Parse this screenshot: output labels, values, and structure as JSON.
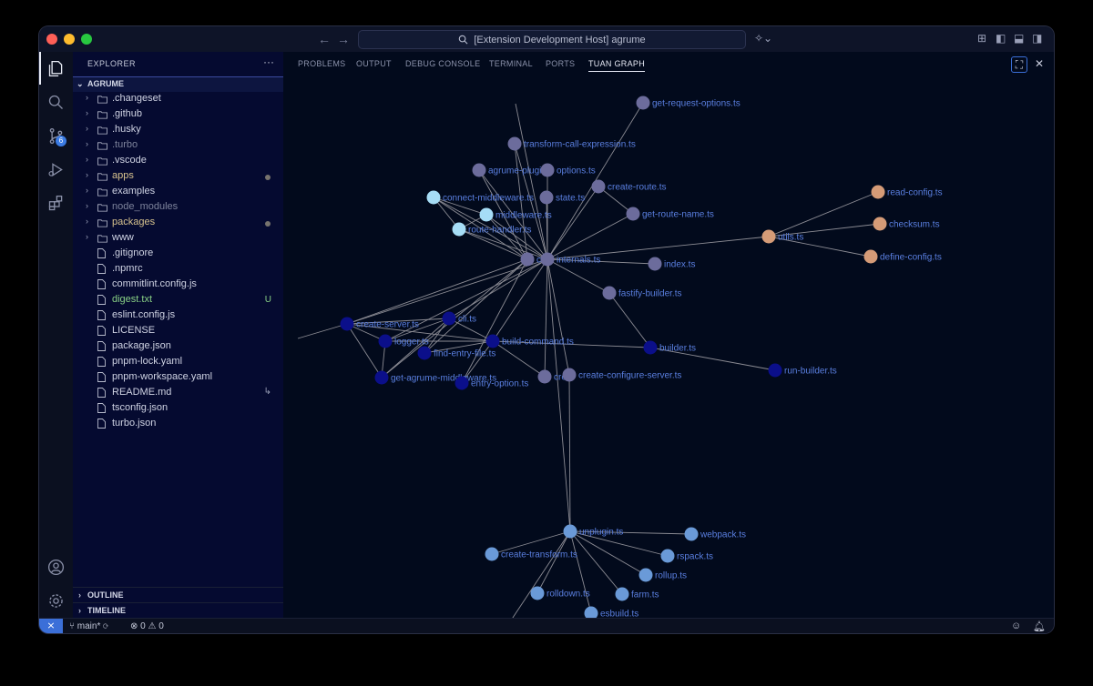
{
  "window": {
    "title": "[Extension Development Host] agrume"
  },
  "sidebar": {
    "title": "EXPLORER",
    "more": "···",
    "root": "AGRUME",
    "items": [
      {
        "label": ".changeset",
        "kind": "folder"
      },
      {
        "label": ".github",
        "kind": "folder"
      },
      {
        "label": ".husky",
        "kind": "folder"
      },
      {
        "label": ".turbo",
        "kind": "folder",
        "dim": true
      },
      {
        "label": ".vscode",
        "kind": "folder"
      },
      {
        "label": "apps",
        "kind": "folder",
        "modified": true
      },
      {
        "label": "examples",
        "kind": "folder"
      },
      {
        "label": "node_modules",
        "kind": "folder",
        "dim": true
      },
      {
        "label": "packages",
        "kind": "folder",
        "modified": true
      },
      {
        "label": "www",
        "kind": "folder"
      },
      {
        "label": ".gitignore",
        "kind": "file"
      },
      {
        "label": ".npmrc",
        "kind": "file"
      },
      {
        "label": "commitlint.config.js",
        "kind": "file"
      },
      {
        "label": "digest.txt",
        "kind": "file",
        "status": "U"
      },
      {
        "label": "eslint.config.js",
        "kind": "file"
      },
      {
        "label": "LICENSE",
        "kind": "file"
      },
      {
        "label": "package.json",
        "kind": "file"
      },
      {
        "label": "pnpm-lock.yaml",
        "kind": "file"
      },
      {
        "label": "pnpm-workspace.yaml",
        "kind": "file"
      },
      {
        "label": "README.md",
        "kind": "file",
        "glyph": "↳"
      },
      {
        "label": "tsconfig.json",
        "kind": "file"
      },
      {
        "label": "turbo.json",
        "kind": "file"
      }
    ],
    "outline": "OUTLINE",
    "timeline": "TIMELINE"
  },
  "activity": {
    "scm_badge": "6"
  },
  "panel": {
    "tabs": [
      "PROBLEMS",
      "OUTPUT",
      "DEBUG CONSOLE",
      "TERMINAL",
      "PORTS",
      "TUAN GRAPH"
    ],
    "active_tab": "TUAN GRAPH"
  },
  "graph": {
    "colors": {
      "purple": "#6c6c9c",
      "lightblue": "#a6ddf6",
      "navy": "#0b0f8a",
      "blue": "#6a9ad8",
      "peach": "#d59b77",
      "edge": "#8c8c94",
      "label": "#5a7fe0"
    },
    "nodes": [
      {
        "id": "get-request-options",
        "label": "get-request-options.ts",
        "color": "purple"
      },
      {
        "id": "transform-call-expression",
        "label": "transform-call-expression.ts",
        "color": "purple"
      },
      {
        "id": "agrume-plugin",
        "label": "agrume-plugin",
        "color": "purple"
      },
      {
        "id": "options",
        "label": "options.ts",
        "color": "purple"
      },
      {
        "id": "create-route",
        "label": "create-route.ts",
        "color": "purple"
      },
      {
        "id": "connect-middleware",
        "label": "connect-middleware.ts",
        "color": "lightblue"
      },
      {
        "id": "state",
        "label": "state.ts",
        "color": "purple"
      },
      {
        "id": "middleware",
        "label": "middleware.ts",
        "color": "lightblue"
      },
      {
        "id": "get-route-name",
        "label": "get-route-name.ts",
        "color": "purple"
      },
      {
        "id": "route-handler",
        "label": "route-handler.ts",
        "color": "lightblue"
      },
      {
        "id": "c",
        "label": "c",
        "color": "purple"
      },
      {
        "id": "internals",
        "label": "internals.ts",
        "color": "purple"
      },
      {
        "id": "index",
        "label": "index.ts",
        "color": "purple"
      },
      {
        "id": "fastify-builder",
        "label": "fastify-builder.ts",
        "color": "purple"
      },
      {
        "id": "read-config",
        "label": "read-config.ts",
        "color": "peach"
      },
      {
        "id": "checksum",
        "label": "checksum.ts",
        "color": "peach"
      },
      {
        "id": "utils",
        "label": "utils.ts",
        "color": "peach"
      },
      {
        "id": "define-config",
        "label": "define-config.ts",
        "color": "peach"
      },
      {
        "id": "create-server",
        "label": "create-server.ts",
        "color": "navy"
      },
      {
        "id": "cli",
        "label": "cli.ts",
        "color": "navy"
      },
      {
        "id": "logger",
        "label": "logger.ts",
        "color": "navy"
      },
      {
        "id": "build-command",
        "label": "build-command.ts",
        "color": "navy"
      },
      {
        "id": "find-entry-file",
        "label": "find-entry-file.ts",
        "color": "navy"
      },
      {
        "id": "builder",
        "label": "builder.ts",
        "color": "navy"
      },
      {
        "id": "run-builder",
        "label": "run-builder.ts",
        "color": "navy"
      },
      {
        "id": "get-agrume-middleware",
        "label": "get-agrume-middleware.ts",
        "color": "navy"
      },
      {
        "id": "entry-option",
        "label": "entry-option.ts",
        "color": "navy"
      },
      {
        "id": "cre",
        "label": "cre",
        "color": "purple"
      },
      {
        "id": "create-configure-server",
        "label": "create-configure-server.ts",
        "color": "purple"
      },
      {
        "id": "unplugin",
        "label": "unplugin.ts",
        "color": "blue"
      },
      {
        "id": "webpack",
        "label": "webpack.ts",
        "color": "blue"
      },
      {
        "id": "create-transform",
        "label": "create-transform.ts",
        "color": "blue"
      },
      {
        "id": "rspack",
        "label": "rspack.ts",
        "color": "blue"
      },
      {
        "id": "rollup",
        "label": "rollup.ts",
        "color": "blue"
      },
      {
        "id": "rolldown",
        "label": "rolldown.ts",
        "color": "blue"
      },
      {
        "id": "farm",
        "label": "farm.ts",
        "color": "blue"
      },
      {
        "id": "esbuild",
        "label": "esbuild.ts",
        "color": "blue"
      }
    ],
    "edges": [
      [
        "internals",
        "get-request-options"
      ],
      [
        "internals",
        "transform-call-expression"
      ],
      [
        "internals",
        "agrume-plugin"
      ],
      [
        "internals",
        "options"
      ],
      [
        "internals",
        "create-route"
      ],
      [
        "internals",
        "state"
      ],
      [
        "internals",
        "connect-middleware"
      ],
      [
        "internals",
        "middleware"
      ],
      [
        "internals",
        "route-handler"
      ],
      [
        "internals",
        "get-route-name"
      ],
      [
        "internals",
        "index"
      ],
      [
        "internals",
        "fastify-builder"
      ],
      [
        "internals",
        "utils"
      ],
      [
        "internals",
        "create-server"
      ],
      [
        "internals",
        "cli"
      ],
      [
        "internals",
        "build-command"
      ],
      [
        "internals",
        "logger"
      ],
      [
        "internals",
        "cre"
      ],
      [
        "internals",
        "create-configure-server"
      ],
      [
        "c",
        "transform-call-expression"
      ],
      [
        "c",
        "agrume-plugin"
      ],
      [
        "c",
        "connect-middleware"
      ],
      [
        "c",
        "middleware"
      ],
      [
        "c",
        "route-handler"
      ],
      [
        "c",
        "entry-option"
      ],
      [
        "c",
        "create-server"
      ],
      [
        "c",
        "find-entry-file"
      ],
      [
        "c",
        "get-agrume-middleware"
      ],
      [
        "connect-middleware",
        "middleware"
      ],
      [
        "connect-middleware",
        "route-handler"
      ],
      [
        "middleware",
        "route-handler"
      ],
      [
        "create-route",
        "get-route-name"
      ],
      [
        "utils",
        "read-config"
      ],
      [
        "utils",
        "checksum"
      ],
      [
        "utils",
        "define-config"
      ],
      [
        "fastify-builder",
        "builder"
      ],
      [
        "builder",
        "run-builder"
      ],
      [
        "build-command",
        "builder"
      ],
      [
        "cli",
        "build-command"
      ],
      [
        "cli",
        "logger"
      ],
      [
        "cli",
        "find-entry-file"
      ],
      [
        "cli",
        "create-server"
      ],
      [
        "create-server",
        "logger"
      ],
      [
        "create-server",
        "get-agrume-middleware"
      ],
      [
        "create-server",
        "build-command"
      ],
      [
        "logger",
        "build-command"
      ],
      [
        "logger",
        "get-agrume-middleware"
      ],
      [
        "find-entry-file",
        "build-command"
      ],
      [
        "build-command",
        "entry-option"
      ],
      [
        "build-command",
        "cre"
      ],
      [
        "cli",
        "get-agrume-middleware"
      ],
      [
        "create-configure-server",
        "unplugin"
      ],
      [
        "unplugin",
        "webpack"
      ],
      [
        "unplugin",
        "create-transform"
      ],
      [
        "unplugin",
        "rspack"
      ],
      [
        "unplugin",
        "rollup"
      ],
      [
        "unplugin",
        "rolldown"
      ],
      [
        "unplugin",
        "farm"
      ],
      [
        "unplugin",
        "esbuild"
      ],
      [
        "unplugin",
        "internals"
      ]
    ]
  },
  "statusbar": {
    "branch": "main*",
    "errors": "0",
    "warnings": "0"
  }
}
